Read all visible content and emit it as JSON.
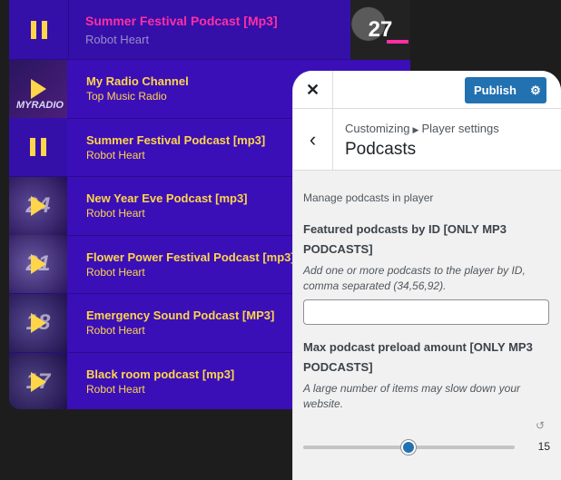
{
  "player": {
    "now_playing": {
      "title": "Summer Festival Podcast [Mp3]",
      "artist": "Robot Heart",
      "thumb_number": "27"
    },
    "items": [
      {
        "title": "My Radio Channel",
        "subtitle": "Top Music Radio",
        "art_text": "MYRADIO",
        "state": "play"
      },
      {
        "title": "Summer Festival Podcast [mp3]",
        "subtitle": "Robot Heart",
        "art_text": "",
        "state": "pause"
      },
      {
        "title": "New Year Eve Podcast [mp3]",
        "subtitle": "Robot Heart",
        "art_text": "24",
        "state": "play"
      },
      {
        "title": "Flower Power Festival Podcast [mp3]",
        "subtitle": "Robot Heart",
        "art_text": "21",
        "state": "play"
      },
      {
        "title": "Emergency Sound Podcast [MP3]",
        "subtitle": "Robot Heart",
        "art_text": "18",
        "state": "play"
      },
      {
        "title": "Black room podcast [mp3]",
        "subtitle": "Robot Heart",
        "art_text": "17",
        "state": "play"
      }
    ]
  },
  "customizer": {
    "publish_label": "Publish",
    "breadcrumb": {
      "root": "Customizing",
      "section": "Player settings"
    },
    "section_title": "Podcasts",
    "description": "Manage podcasts in player",
    "featured": {
      "label": "Featured podcasts by ID [ONLY MP3 PODCASTS]",
      "help": "Add one or more podcasts to the player by ID, comma separated (34,56,92).",
      "value": ""
    },
    "preload": {
      "label": "Max podcast preload amount [ONLY MP3 PODCASTS]",
      "help": "A large number of items may slow down your website.",
      "value": "15"
    }
  },
  "colors": {
    "player_bg": "#3a0fb8",
    "accent_yellow": "#ffd54a",
    "accent_pink": "#ff2fa3",
    "wp_blue": "#2271b1"
  }
}
